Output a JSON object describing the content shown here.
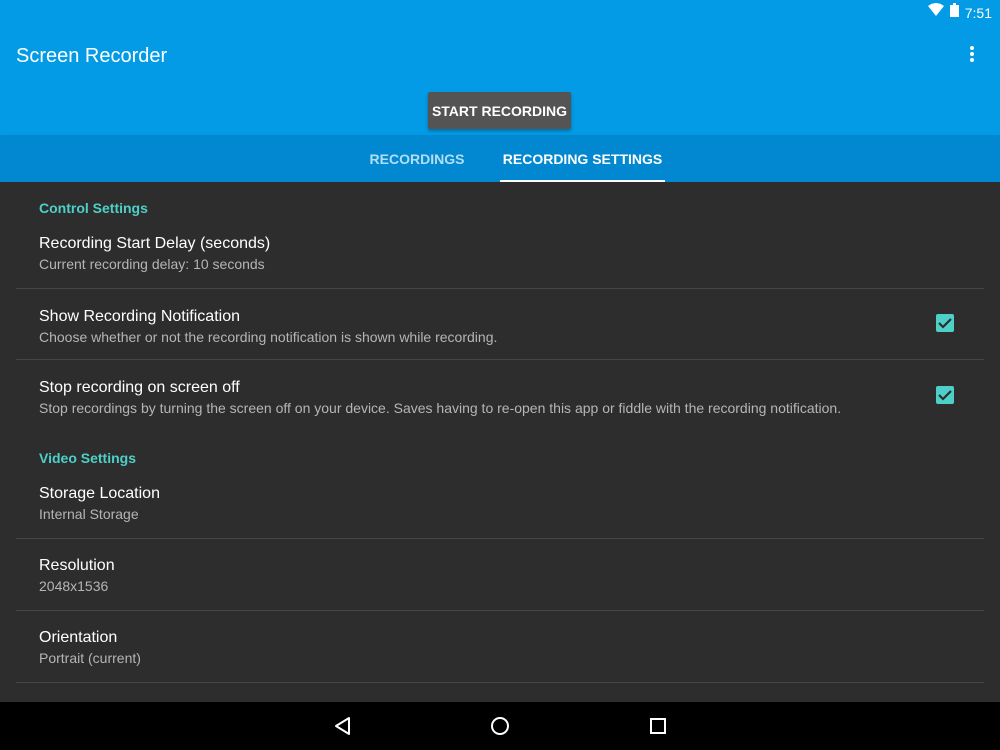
{
  "status_bar": {
    "time": "7:51",
    "icons": [
      "wifi-icon",
      "battery-icon"
    ]
  },
  "app_bar": {
    "title": "Screen Recorder",
    "overflow_icon": "more-vert-icon",
    "start_button_label": "START RECORDING"
  },
  "tabs": [
    {
      "label": "RECORDINGS",
      "selected": false
    },
    {
      "label": "RECORDING SETTINGS",
      "selected": true
    }
  ],
  "settings": {
    "control": {
      "header": "Control Settings",
      "start_delay": {
        "title": "Recording Start Delay (seconds)",
        "summary": "Current recording delay: 10 seconds"
      },
      "show_notification": {
        "title": "Show Recording Notification",
        "summary": "Choose whether or not the recording notification is shown while recording.",
        "checked": true
      },
      "stop_on_screen_off": {
        "title": "Stop recording on screen off",
        "summary": "Stop recordings by turning the screen off on your device. Saves having to re-open this app or fiddle with the recording notification.",
        "checked": true
      }
    },
    "video": {
      "header": "Video Settings",
      "storage_location": {
        "title": "Storage Location",
        "summary": "Internal Storage"
      },
      "resolution": {
        "title": "Resolution",
        "summary": "2048x1536"
      },
      "orientation": {
        "title": "Orientation",
        "summary": "Portrait (current)"
      }
    }
  },
  "colors": {
    "primary": "#039be5",
    "primary_dark": "#0288d1",
    "accent": "#4dd0c8",
    "background": "#2d2d2d",
    "button": "#545454"
  },
  "nav_bar": {
    "icons": [
      "back-icon",
      "home-icon",
      "recents-icon"
    ]
  }
}
